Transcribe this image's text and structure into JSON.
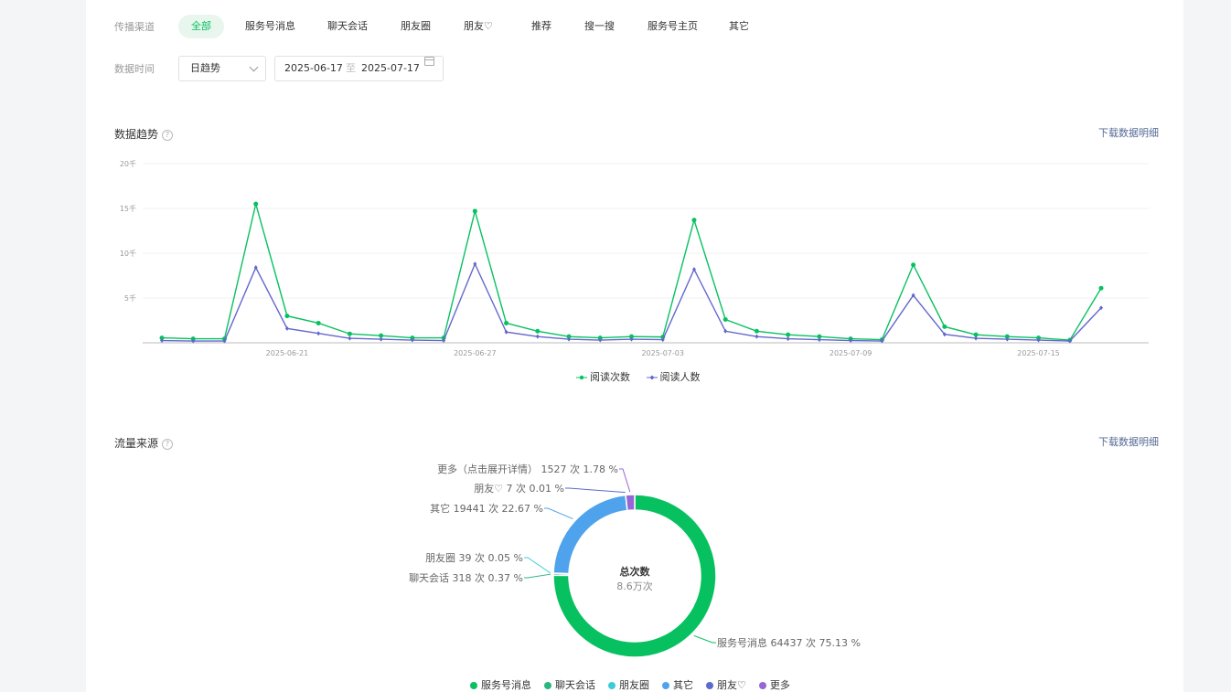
{
  "filters": {
    "channel_label": "传播渠道",
    "channels": [
      "全部",
      "服务号消息",
      "聊天会话",
      "朋友圈",
      "朋友♡",
      "推荐",
      "搜一搜",
      "服务号主页",
      "其它"
    ],
    "active_channel": "全部",
    "time_label": "数据时间",
    "granularity": "日趋势",
    "date_start": "2025-06-17",
    "date_sep": "至",
    "date_end": "2025-07-17"
  },
  "trend": {
    "title": "数据趋势",
    "help": "?",
    "download": "下载数据明细"
  },
  "source": {
    "title": "流量来源",
    "help": "?",
    "download": "下载数据明细"
  },
  "chart_data": [
    {
      "type": "line",
      "x": [
        "2025-06-17",
        "2025-06-18",
        "2025-06-19",
        "2025-06-20",
        "2025-06-21",
        "2025-06-22",
        "2025-06-23",
        "2025-06-24",
        "2025-06-25",
        "2025-06-26",
        "2025-06-27",
        "2025-06-28",
        "2025-06-29",
        "2025-06-30",
        "2025-07-01",
        "2025-07-02",
        "2025-07-03",
        "2025-07-04",
        "2025-07-05",
        "2025-07-06",
        "2025-07-07",
        "2025-07-08",
        "2025-07-09",
        "2025-07-10",
        "2025-07-11",
        "2025-07-12",
        "2025-07-13",
        "2025-07-14",
        "2025-07-15",
        "2025-07-16",
        "2025-07-17"
      ],
      "x_ticks": [
        "2025-06-21",
        "2025-06-27",
        "2025-07-03",
        "2025-07-09",
        "2025-07-15"
      ],
      "y_ticks": [
        "5千",
        "10千",
        "15千",
        "20千"
      ],
      "ylim": [
        0,
        20000
      ],
      "grid": true,
      "legend_position": "bottom",
      "series": [
        {
          "name": "阅读次数",
          "color": "#07c160",
          "values": [
            550,
            450,
            450,
            15500,
            3000,
            2200,
            1000,
            800,
            550,
            550,
            14700,
            2200,
            1300,
            700,
            550,
            700,
            650,
            13700,
            2600,
            1300,
            900,
            700,
            450,
            350,
            8700,
            1800,
            900,
            700,
            550,
            300,
            6100
          ]
        },
        {
          "name": "阅读人数",
          "color": "#6467cd",
          "values": [
            250,
            200,
            200,
            8400,
            1600,
            1050,
            500,
            400,
            300,
            250,
            8800,
            1200,
            700,
            400,
            300,
            400,
            350,
            8200,
            1300,
            700,
            450,
            350,
            250,
            200,
            5300,
            950,
            500,
            400,
            300,
            200,
            3900
          ]
        }
      ]
    },
    {
      "type": "pie",
      "center_title": "总次数",
      "center_value": "8.6万次",
      "legend_position": "bottom",
      "slices": [
        {
          "name": "服务号消息",
          "count": 64437,
          "percent": 75.13,
          "color": "#07c160",
          "label": "服务号消息 64437 次 75.13 %"
        },
        {
          "name": "聊天会话",
          "count": 318,
          "percent": 0.37,
          "color": "#2bb67f",
          "label": "聊天会话 318 次 0.37 %"
        },
        {
          "name": "朋友圈",
          "count": 39,
          "percent": 0.05,
          "color": "#3ccbd8",
          "label": "朋友圈 39 次 0.05 %"
        },
        {
          "name": "其它",
          "count": 19441,
          "percent": 22.67,
          "color": "#4fa3ec",
          "label": "其它 19441 次 22.67 %"
        },
        {
          "name": "朋友♡",
          "count": 7,
          "percent": 0.01,
          "color": "#5b6acd",
          "label": "朋友♡ 7 次 0.01 %"
        },
        {
          "name": "更多",
          "count": 1527,
          "percent": 1.78,
          "color": "#9566d4",
          "label": "更多（点击展开详情） 1527 次 1.78 %"
        }
      ]
    }
  ]
}
